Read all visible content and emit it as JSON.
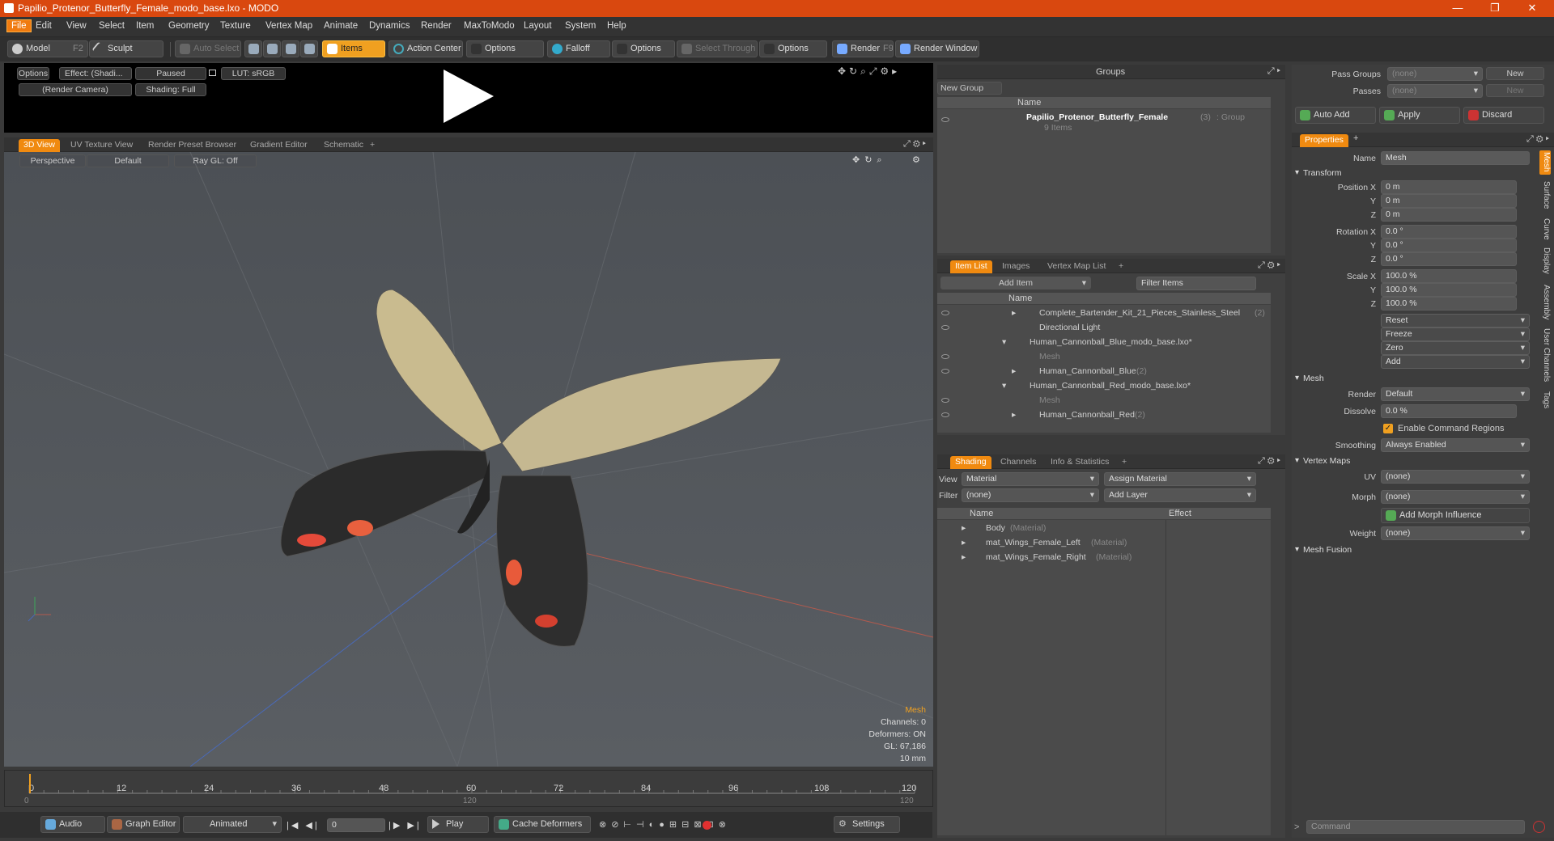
{
  "window": {
    "title": "Papilio_Protenor_Butterfly_Female_modo_base.lxo - MODO",
    "minimize": "—",
    "maximize": "❐",
    "close": "✕"
  },
  "menu": [
    "File",
    "Edit",
    "View",
    "Select",
    "Item",
    "Geometry",
    "Texture",
    "Vertex Map",
    "Animate",
    "Dynamics",
    "Render",
    "MaxToModo",
    "Layout",
    "System",
    "Help"
  ],
  "toolbar": {
    "model": "Model",
    "model_key": "F2",
    "sculpt": "Sculpt",
    "auto_select": "Auto Select",
    "items": "Items",
    "action_center": "Action Center",
    "options1": "Options",
    "falloff": "Falloff",
    "options2": "Options",
    "select_through": "Select Through",
    "options3": "Options",
    "render": "Render",
    "render_key": "F9",
    "render_window": "Render Window"
  },
  "preview": {
    "options": "Options",
    "effect": "Effect: (Shadi...",
    "paused": "Paused",
    "lut": "LUT: sRGB",
    "camera": "(Render Camera)",
    "shading": "Shading: Full"
  },
  "viewport_tabs": [
    "3D View",
    "UV Texture View",
    "Render Preset Browser",
    "Gradient Editor",
    "Schematic",
    "+"
  ],
  "viewport": {
    "perspective": "Perspective",
    "default": "Default",
    "raygl": "Ray GL: Off",
    "info": {
      "title": "Mesh",
      "channels": "Channels: 0",
      "deformers": "Deformers: ON",
      "gl": "GL: 67,186",
      "size": "10 mm"
    }
  },
  "timeline": {
    "ticks": [
      "0",
      "12",
      "24",
      "36",
      "48",
      "60",
      "72",
      "84",
      "96",
      "108",
      "120"
    ],
    "bottom_left": "0",
    "bottom_mid": "120",
    "bottom_right": "120"
  },
  "bottombar": {
    "audio": "Audio",
    "graph_editor": "Graph Editor",
    "animated": "Animated",
    "frame": "0",
    "play": "Play",
    "cache": "Cache Deformers",
    "settings": "Settings"
  },
  "groups": {
    "title": "Groups",
    "new_group": "New Group",
    "col_name": "Name",
    "row_name": "Papilio_Protenor_Butterfly_Female",
    "row_count": "(3)",
    "row_type": ": Group",
    "row_sub": "9 Items"
  },
  "itemlist": {
    "tabs": [
      "Item List",
      "Images",
      "Vertex Map List",
      "+"
    ],
    "add_item": "Add Item",
    "filter": "Filter Items",
    "col_name": "Name",
    "rows": [
      {
        "label": "Complete_Bartender_Kit_21_Pieces_Stainless_Steel",
        "suffix": "(2)"
      },
      {
        "label": "Directional Light",
        "suffix": ""
      },
      {
        "label": "Human_Cannonball_Blue_modo_base.lxo*",
        "suffix": ""
      },
      {
        "label": "Mesh",
        "suffix": ""
      },
      {
        "label": "Human_Cannonball_Blue",
        "suffix": "(2)"
      },
      {
        "label": "Human_Cannonball_Red_modo_base.lxo*",
        "suffix": ""
      },
      {
        "label": "Mesh",
        "suffix": ""
      },
      {
        "label": "Human_Cannonball_Red",
        "suffix": "(2)"
      }
    ]
  },
  "shading": {
    "tabs": [
      "Shading",
      "Channels",
      "Info & Statistics",
      "+"
    ],
    "view_label": "View",
    "view_value": "Material",
    "assign": "Assign Material",
    "filter_label": "Filter",
    "filter_value": "(none)",
    "add_layer": "Add Layer",
    "col_name": "Name",
    "col_effect": "Effect",
    "rows": [
      {
        "label": "Body",
        "type": "(Material)"
      },
      {
        "label": "mat_Wings_Female_Left",
        "type": "(Material)"
      },
      {
        "label": "mat_Wings_Female_Right",
        "type": "(Material)"
      }
    ]
  },
  "passes": {
    "pass_groups": "Pass Groups",
    "pass_value": "(none)",
    "new": "New",
    "passes": "Passes",
    "passes_value": "(none)",
    "new2": "New",
    "auto_add": "Auto Add",
    "apply": "Apply",
    "discard": "Discard"
  },
  "properties": {
    "tab": "Properties",
    "name_label": "Name",
    "name_value": "Mesh",
    "transform": "Transform",
    "pos_label": "Position X",
    "y": "Y",
    "z": "Z",
    "pos": [
      "0 m",
      "0 m",
      "0 m"
    ],
    "rot_label": "Rotation X",
    "rot": [
      "0.0 °",
      "0.0 °",
      "0.0 °"
    ],
    "scale_label": "Scale X",
    "scale": [
      "100.0 %",
      "100.0 %",
      "100.0 %"
    ],
    "reset": "Reset",
    "freeze": "Freeze",
    "zero": "Zero",
    "add": "Add",
    "mesh": "Mesh",
    "render_label": "Render",
    "render_value": "Default",
    "dissolve_label": "Dissolve",
    "dissolve_value": "0.0 %",
    "enable_cmd": "Enable Command Regions",
    "smoothing_label": "Smoothing",
    "smoothing_value": "Always Enabled",
    "vertex_maps": "Vertex Maps",
    "uv_label": "UV",
    "uv_value": "(none)",
    "morph_label": "Morph",
    "morph_value": "(none)",
    "add_morph": "Add Morph Influence",
    "weight_label": "Weight",
    "weight_value": "(none)",
    "mesh_fusion": "Mesh Fusion",
    "side_tabs": [
      "Mesh",
      "Surface",
      "Curve",
      "Display",
      "Assembly",
      "User Channels",
      "Tags"
    ]
  },
  "command": "Command",
  "colors": {
    "accent": "#f08a10",
    "title": "#d9480f"
  }
}
